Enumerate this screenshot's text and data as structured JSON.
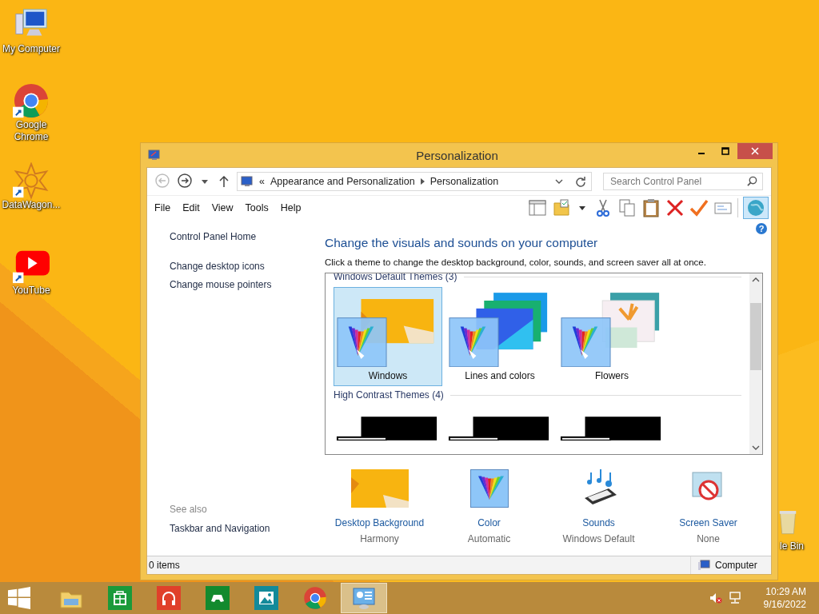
{
  "desktop_icons": [
    {
      "label": "My Computer",
      "kind": "computer"
    },
    {
      "label": "Google Chrome",
      "kind": "chrome"
    },
    {
      "label": "DataWagon...",
      "kind": "datawagon"
    },
    {
      "label": "YouTube",
      "kind": "youtube"
    }
  ],
  "recycle_bin": {
    "label": "le Bin"
  },
  "window": {
    "title": "Personalization",
    "address": {
      "prefix": "«",
      "path": [
        "Appearance and Personalization",
        "Personalization"
      ]
    },
    "search": {
      "placeholder": "Search Control Panel"
    },
    "menu": [
      "File",
      "Edit",
      "View",
      "Tools",
      "Help"
    ],
    "help": "?",
    "sidebar": {
      "links": [
        "Control Panel Home",
        "Change desktop icons",
        "Change mouse pointers"
      ],
      "see_also": {
        "heading": "See also",
        "links": [
          "Taskbar and Navigation"
        ]
      }
    },
    "heading": "Change the visuals and sounds on your computer",
    "description": "Click a theme to change the desktop background, color, sounds, and screen saver all at once.",
    "theme_groups": [
      {
        "title": "Windows Default Themes (3)",
        "items": [
          {
            "name": "Windows",
            "kind": "windows",
            "selected": true
          },
          {
            "name": "Lines and colors",
            "kind": "lines",
            "selected": false
          },
          {
            "name": "Flowers",
            "kind": "flowers",
            "selected": false
          }
        ]
      },
      {
        "title": "High Contrast Themes (4)",
        "items": [
          {
            "kind": "contrast",
            "selected": false
          },
          {
            "kind": "contrast",
            "selected": false
          },
          {
            "kind": "contrast",
            "selected": false
          }
        ]
      }
    ],
    "settings": [
      {
        "label": "Desktop Background",
        "value": "Harmony",
        "kind": "background"
      },
      {
        "label": "Color",
        "value": "Automatic",
        "kind": "color"
      },
      {
        "label": "Sounds",
        "value": "Windows Default",
        "kind": "sounds"
      },
      {
        "label": "Screen Saver",
        "value": "None",
        "kind": "screensaver"
      }
    ],
    "status_bar": {
      "items": "0 items",
      "location": "Computer"
    }
  },
  "taskbar": {
    "apps": [
      {
        "kind": "explorer",
        "selected": false
      },
      {
        "kind": "store",
        "selected": false
      },
      {
        "kind": "music",
        "selected": false
      },
      {
        "kind": "xbox",
        "selected": false
      },
      {
        "kind": "photos",
        "selected": false
      },
      {
        "kind": "chrome",
        "selected": false
      },
      {
        "kind": "control",
        "selected": true
      }
    ],
    "time": "10:29 AM",
    "date": "9/16/2022"
  }
}
